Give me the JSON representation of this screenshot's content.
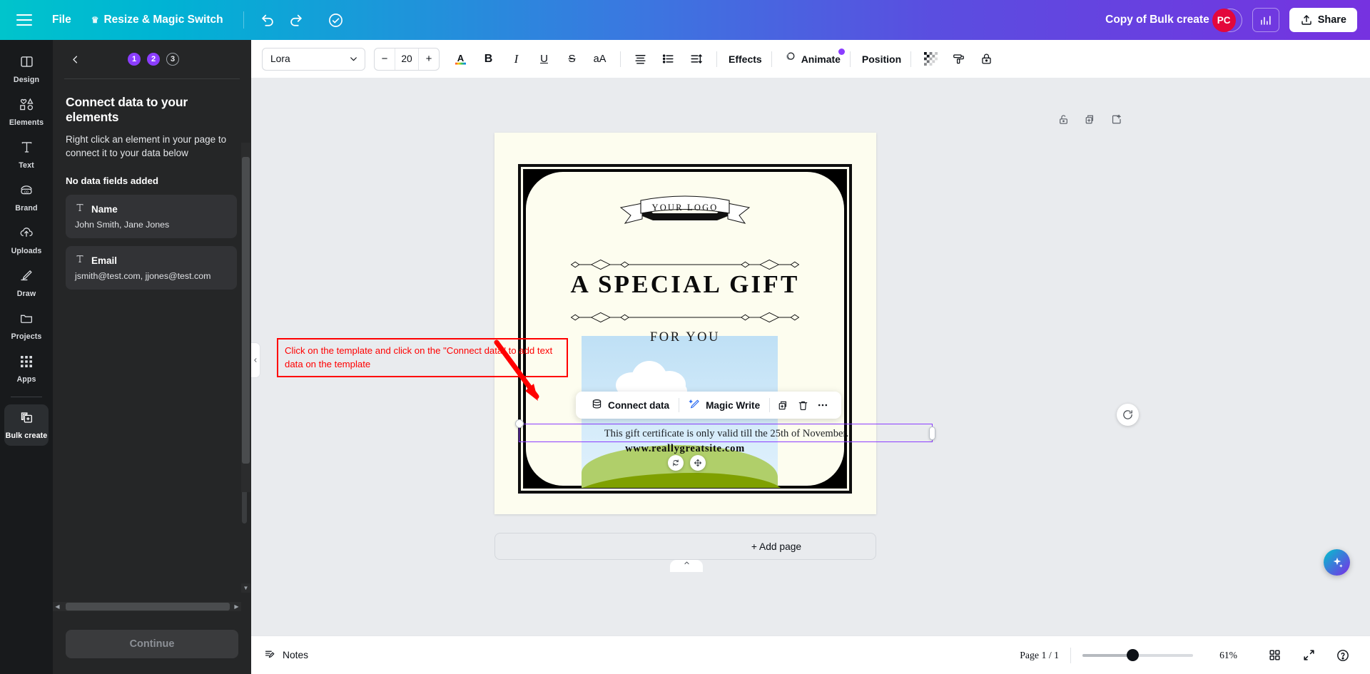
{
  "header": {
    "menu_icon": "hamburger-icon",
    "file_label": "File",
    "resize_label": "Resize & Magic Switch",
    "crown_icon": "crown-icon",
    "undo_icon": "undo-icon",
    "redo_icon": "redo-icon",
    "cloud_icon": "cloud-sync-icon",
    "doc_title": "Copy of Bulk create",
    "avatar_initials": "PC",
    "avatar_color": "#e3073c",
    "add_collab_label": "+",
    "stats_icon": "bar-chart-icon",
    "share_label": "Share",
    "share_icon": "upload-icon"
  },
  "rail": {
    "items": [
      {
        "label": "Design",
        "icon": "layout-icon"
      },
      {
        "label": "Elements",
        "icon": "shapes-icon"
      },
      {
        "label": "Text",
        "icon": "text-t-icon"
      },
      {
        "label": "Brand",
        "icon": "brand-icon"
      },
      {
        "label": "Uploads",
        "icon": "upload-cloud-icon"
      },
      {
        "label": "Draw",
        "icon": "pencil-icon"
      },
      {
        "label": "Projects",
        "icon": "folder-icon"
      },
      {
        "label": "Apps",
        "icon": "grid-apps-icon"
      }
    ],
    "active": {
      "label": "Bulk create",
      "icon": "bulk-create-icon"
    }
  },
  "panel": {
    "back_icon": "chevron-left-icon",
    "steps": [
      {
        "num": "1",
        "state": "done"
      },
      {
        "num": "2",
        "state": "done"
      },
      {
        "num": "3",
        "state": "todo"
      }
    ],
    "title": "Connect data to your elements",
    "subtitle": "Right click an element in your page to connect it to your data below",
    "no_fields_label": "No data fields added",
    "fields": [
      {
        "icon": "text-field-icon",
        "name": "Name",
        "values": "John Smith, Jane Jones"
      },
      {
        "icon": "text-field-icon",
        "name": "Email",
        "values": "jsmith@test.com, jjones@test.com"
      }
    ],
    "continue_label": "Continue",
    "collapse_icon": "chevron-left-icon"
  },
  "toolbar": {
    "font_name": "Lora",
    "font_dropdown_icon": "chevron-down-icon",
    "font_size": "20",
    "decrease_label": "−",
    "increase_label": "+",
    "text_color_icon": "text-color-icon",
    "bold_label": "B",
    "italic_label": "I",
    "underline_label": "U",
    "strike_label": "S",
    "case_label": "aA",
    "align_icon": "align-icon",
    "list_icon": "bullet-list-icon",
    "spacing_icon": "line-spacing-icon",
    "effects_label": "Effects",
    "animate_label": "Animate",
    "animate_icon": "animate-icon",
    "position_label": "Position",
    "transparency_icon": "transparency-icon",
    "roller_icon": "paint-roller-icon",
    "lock_icon": "lock-icon"
  },
  "page_tools": {
    "lock_icon": "unlock-icon",
    "duplicate_icon": "duplicate-page-icon",
    "addpage_icon": "add-page-icon"
  },
  "design": {
    "logo_text": "YOUR LOGO",
    "title": "A SPECIAL GIFT",
    "for_you": "FOR YOU",
    "website": "www.reallygreatsite.com"
  },
  "annotation": {
    "text": "Click on the template and click on the \"Connect data\" to add text data on the template",
    "color": "#ff0000",
    "arrow_icon": "red-arrow-icon"
  },
  "context_toolbar": {
    "connect_data_label": "Connect data",
    "connect_data_icon": "database-icon",
    "magic_write_label": "Magic Write",
    "magic_write_icon": "magic-pen-icon",
    "duplicate_icon": "duplicate-icon",
    "delete_icon": "trash-icon",
    "more_icon": "more-dots-icon"
  },
  "selection": {
    "text": "This gift certificate is only valid till the 25th of November.",
    "border_color": "#8b3dff",
    "rotate_icon": "rotate-icon",
    "move_icon": "move-icon"
  },
  "canvas": {
    "add_page_label": "+ Add page",
    "caret_icon": "chevron-up-icon",
    "ai_icon": "magic-sparkle-icon",
    "comment_icon": "comment-icon"
  },
  "statusbar": {
    "notes_label": "Notes",
    "notes_icon": "notes-icon",
    "page_label": "Page 1 / 1",
    "zoom_value": "61%",
    "grid_icon": "grid-view-icon",
    "fullscreen_icon": "expand-icon",
    "help_icon": "help-circle-icon"
  }
}
